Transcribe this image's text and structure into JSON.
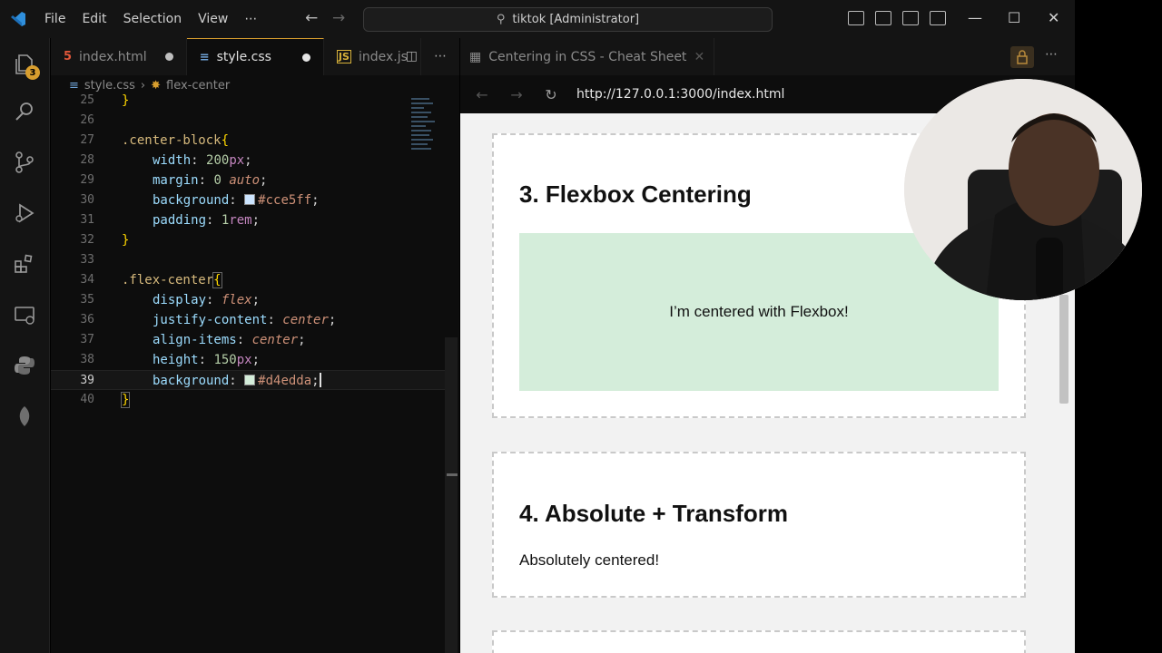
{
  "menu": [
    "File",
    "Edit",
    "Selection",
    "View",
    "⋯"
  ],
  "command_center": "tiktok [Administrator]",
  "activity": {
    "badge_count": "3"
  },
  "editor": {
    "tabs": [
      {
        "label": "index.html",
        "icon": "html-icon",
        "modified": true
      },
      {
        "label": "style.css",
        "icon": "css-icon",
        "modified": true,
        "active": true
      },
      {
        "label": "index.js",
        "icon": "js-icon",
        "modified": false
      }
    ],
    "breadcrumb": {
      "file": "style.css",
      "symbol": "flex-center"
    },
    "lines": [
      "25",
      "26",
      "27",
      "28",
      "29",
      "30",
      "31",
      "32",
      "33",
      "34",
      "35",
      "36",
      "37",
      "38",
      "39",
      "40"
    ]
  },
  "browser": {
    "tab_title": "Centering in CSS - Cheat Sheet",
    "url": "http://127.0.0.1:3000/index.html",
    "sections": [
      {
        "title": "3. Flexbox Centering",
        "content": "I’m centered with Flexbox!"
      },
      {
        "title": "4. Absolute + Transform",
        "content": "Absolutely centered!"
      }
    ]
  },
  "colors": {
    "accent": "#d89e2e",
    "flex_bg": "#d4edda",
    "block_bg": "#cce5ff"
  }
}
